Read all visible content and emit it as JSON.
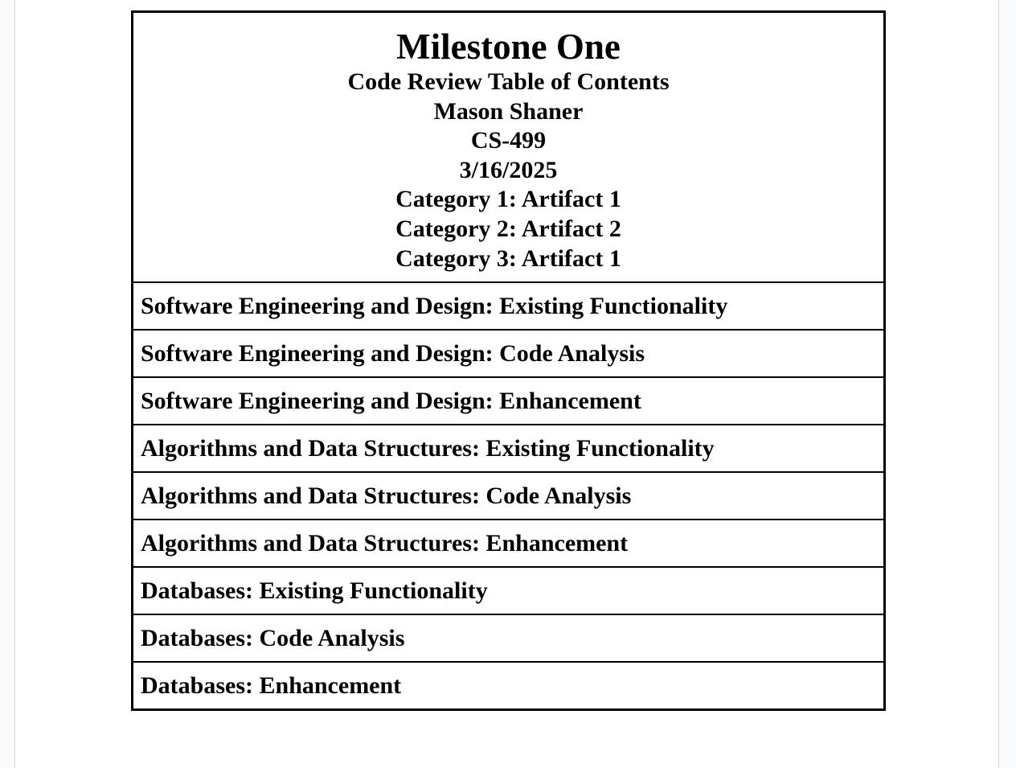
{
  "document": {
    "title": "Milestone One",
    "subtitle": "Code Review Table of Contents",
    "author": "Mason Shaner",
    "course": "CS-499",
    "date": "3/16/2025",
    "categories": [
      "Category 1: Artifact 1",
      "Category 2: Artifact 2",
      "Category 3: Artifact 1"
    ],
    "sections": [
      "Software Engineering and Design: Existing Functionality",
      "Software Engineering and Design: Code Analysis",
      "Software Engineering and Design: Enhancement",
      "Algorithms and Data Structures: Existing Functionality",
      "Algorithms and Data Structures: Code Analysis",
      "Algorithms and Data Structures: Enhancement",
      "Databases: Existing Functionality",
      "Databases: Code Analysis",
      "Databases: Enhancement"
    ]
  }
}
